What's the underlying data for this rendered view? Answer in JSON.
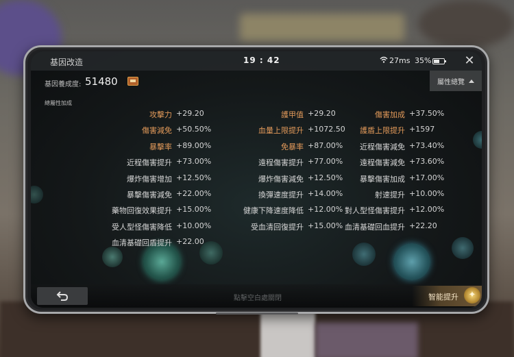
{
  "topbar": {
    "title": "基因改造",
    "time": "19 : 42",
    "wifi_icon": "wifi-icon",
    "ping": "27ms",
    "battery": "35%",
    "close_icon": "close-icon"
  },
  "header": {
    "score_label": "基因養成度:",
    "score_value": "51480",
    "overview_label": "屬性總覽"
  },
  "section_label": "總屬性加成",
  "stats": [
    [
      {
        "name": "攻擊力",
        "value": "+29.20",
        "highlight": true
      },
      {
        "name": "傷害減免",
        "value": "+50.50%",
        "highlight": true
      },
      {
        "name": "暴擊率",
        "value": "+89.00%",
        "highlight": true
      },
      {
        "name": "近程傷害提升",
        "value": "+73.00%",
        "highlight": false
      },
      {
        "name": "爆炸傷害增加",
        "value": "+12.50%",
        "highlight": false
      },
      {
        "name": "暴擊傷害減免",
        "value": "+22.00%",
        "highlight": false
      },
      {
        "name": "藥物回復效果提升",
        "value": "+15.00%",
        "highlight": false
      },
      {
        "name": "受人型怪傷害降低",
        "value": "+10.00%",
        "highlight": false
      },
      {
        "name": "血清基礎回盾提升",
        "value": "+22.00",
        "highlight": false
      }
    ],
    [
      {
        "name": "護甲值",
        "value": "+29.20",
        "highlight": true
      },
      {
        "name": "血量上限提升",
        "value": "+1072.50",
        "highlight": true
      },
      {
        "name": "免暴率",
        "value": "+87.00%",
        "highlight": true
      },
      {
        "name": "遠程傷害提升",
        "value": "+77.00%",
        "highlight": false
      },
      {
        "name": "爆炸傷害減免",
        "value": "+12.50%",
        "highlight": false
      },
      {
        "name": "換彈速度提升",
        "value": "+14.00%",
        "highlight": false
      },
      {
        "name": "健康下降速度降低",
        "value": "+12.00%",
        "highlight": false
      },
      {
        "name": "受血清回復提升",
        "value": "+15.00%",
        "highlight": false
      }
    ],
    [
      {
        "name": "傷害加成",
        "value": "+37.50%",
        "highlight": true
      },
      {
        "name": "護盾上限提升",
        "value": "+1597",
        "highlight": true
      },
      {
        "name": "近程傷害減免",
        "value": "+73.40%",
        "highlight": false
      },
      {
        "name": "遠程傷害減免",
        "value": "+73.60%",
        "highlight": false
      },
      {
        "name": "暴擊傷害加成",
        "value": "+17.00%",
        "highlight": false
      },
      {
        "name": "射速提升",
        "value": "+10.00%",
        "highlight": false
      },
      {
        "name": "對人型怪傷害提升",
        "value": "+12.00%",
        "highlight": false
      },
      {
        "name": "血清基礎回血提升",
        "value": "+22.20",
        "highlight": false
      }
    ]
  ],
  "bottombar": {
    "back_icon": "back-arrow-icon",
    "hint": "點擊空白處關閉",
    "smart_label": "智能提升",
    "bulb_icon": "lightbulb-icon"
  },
  "colors": {
    "highlight": "#e39a5a",
    "normal": "#d6d6d6"
  }
}
